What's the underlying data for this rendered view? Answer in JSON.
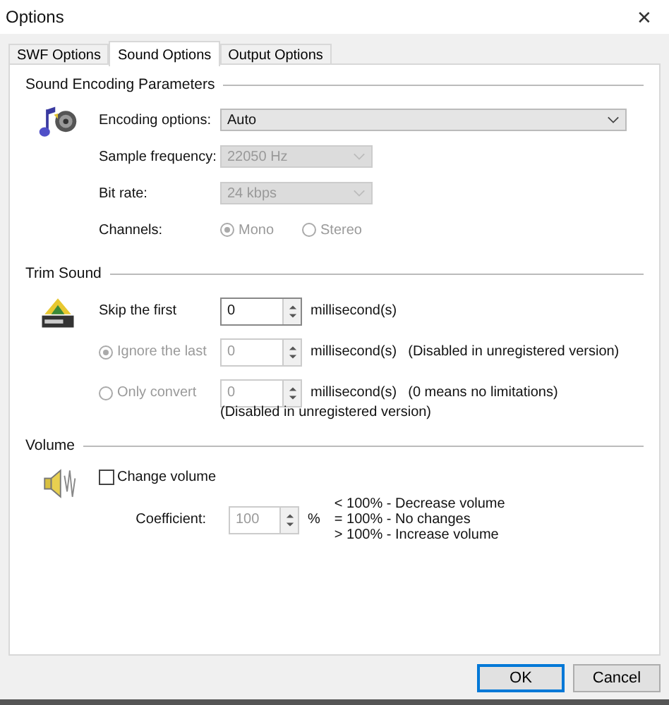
{
  "window": {
    "title": "Options",
    "close": "✕"
  },
  "tabs": [
    {
      "label": "SWF Options",
      "selected": false
    },
    {
      "label": "Sound Options",
      "selected": true
    },
    {
      "label": "Output Options",
      "selected": false
    }
  ],
  "encoding": {
    "title": "Sound Encoding Parameters",
    "fields": [
      {
        "label": "Encoding options:",
        "value": "Auto",
        "disabled": false,
        "wide": true
      },
      {
        "label": "Sample frequency:",
        "value": "22050 Hz",
        "disabled": true,
        "wide": false
      },
      {
        "label": "Bit rate:",
        "value": "24 kbps",
        "disabled": true,
        "wide": false
      }
    ],
    "channels_label": "Channels:",
    "channels": [
      {
        "label": "Mono",
        "selected": true,
        "disabled": true
      },
      {
        "label": "Stereo",
        "selected": false,
        "disabled": true
      }
    ]
  },
  "trim": {
    "title": "Trim Sound",
    "rows": [
      {
        "kind": "plain",
        "label": "Skip the first",
        "value": "0",
        "unit": "millisecond(s)",
        "note": "",
        "disabled": false
      },
      {
        "kind": "radio",
        "label": "Ignore the last",
        "value": "0",
        "unit": "millisecond(s)",
        "note": "(Disabled in unregistered version)",
        "disabled": true,
        "selected": true
      },
      {
        "kind": "radio",
        "label": "Only convert",
        "value": "0",
        "unit": "millisecond(s)",
        "note": "(0 means no limitations)",
        "disabled": true,
        "selected": false
      }
    ],
    "footnote": "(Disabled in unregistered version)"
  },
  "volume": {
    "title": "Volume",
    "checkbox": {
      "label": "Change volume",
      "checked": false
    },
    "coefficient_label": "Coefficient:",
    "coefficient": "100",
    "coefficient_disabled": true,
    "unit": "%",
    "hints": [
      "< 100% - Decrease volume",
      "= 100% - No changes",
      "> 100% - Increase volume"
    ]
  },
  "buttons": [
    {
      "label": "OK",
      "default": true
    },
    {
      "label": "Cancel",
      "default": false
    }
  ]
}
